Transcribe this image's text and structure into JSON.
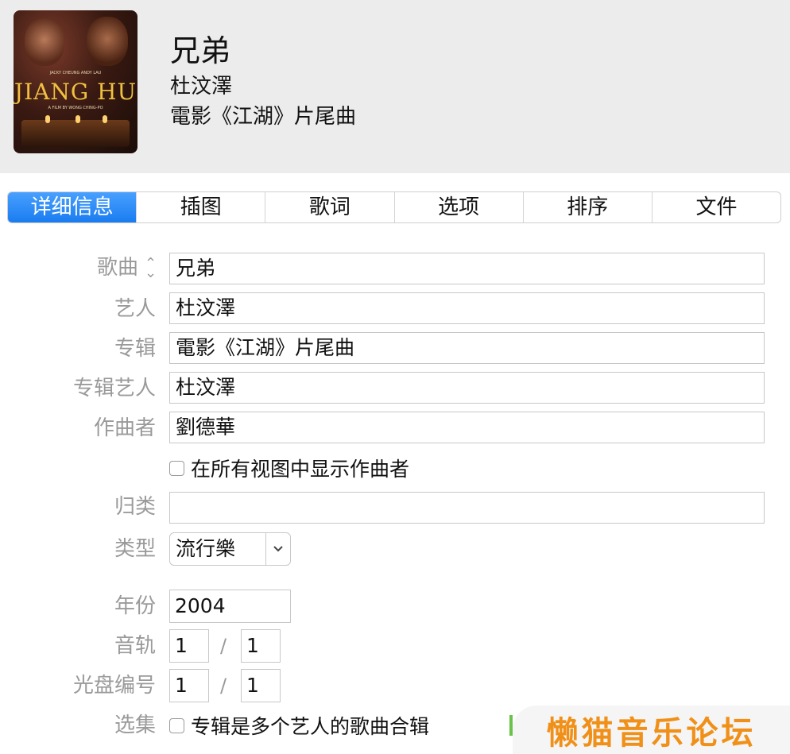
{
  "header": {
    "title": "兄弟",
    "artist": "杜汶澤",
    "album": "電影《江湖》片尾曲",
    "cover": {
      "logo": "JIANG HU",
      "credits": "JACKY CHEUNG        ANDY LAU",
      "byline": "A FILM BY WONG CHING-PO"
    }
  },
  "tabs": [
    {
      "label": "详细信息",
      "active": true
    },
    {
      "label": "插图"
    },
    {
      "label": "歌词"
    },
    {
      "label": "选项"
    },
    {
      "label": "排序"
    },
    {
      "label": "文件"
    }
  ],
  "form": {
    "song": {
      "label": "歌曲",
      "value": "兄弟"
    },
    "artist": {
      "label": "艺人",
      "value": "杜汶澤"
    },
    "album": {
      "label": "专辑",
      "value": "電影《江湖》片尾曲"
    },
    "album_artist": {
      "label": "专辑艺人",
      "value": "杜汶澤"
    },
    "composer": {
      "label": "作曲者",
      "value": "劉德華"
    },
    "show_composer": {
      "label": "在所有视图中显示作曲者",
      "checked": false
    },
    "grouping": {
      "label": "归类",
      "value": ""
    },
    "genre": {
      "label": "类型",
      "value": "流行樂"
    },
    "year": {
      "label": "年份",
      "value": "2004"
    },
    "track": {
      "label": "音轨",
      "number": "1",
      "of": "1",
      "separator": "/"
    },
    "disc": {
      "label": "光盘编号",
      "number": "1",
      "of": "1",
      "separator": "/"
    },
    "compilation": {
      "label": "选集",
      "checkbox_label": "专辑是多个艺人的歌曲合辑",
      "checked": false
    }
  },
  "watermark": "懒猫音乐论坛",
  "colors": {
    "accent": "#1a7cf0",
    "label": "#9a9a9a",
    "watermark": "#f09018"
  }
}
